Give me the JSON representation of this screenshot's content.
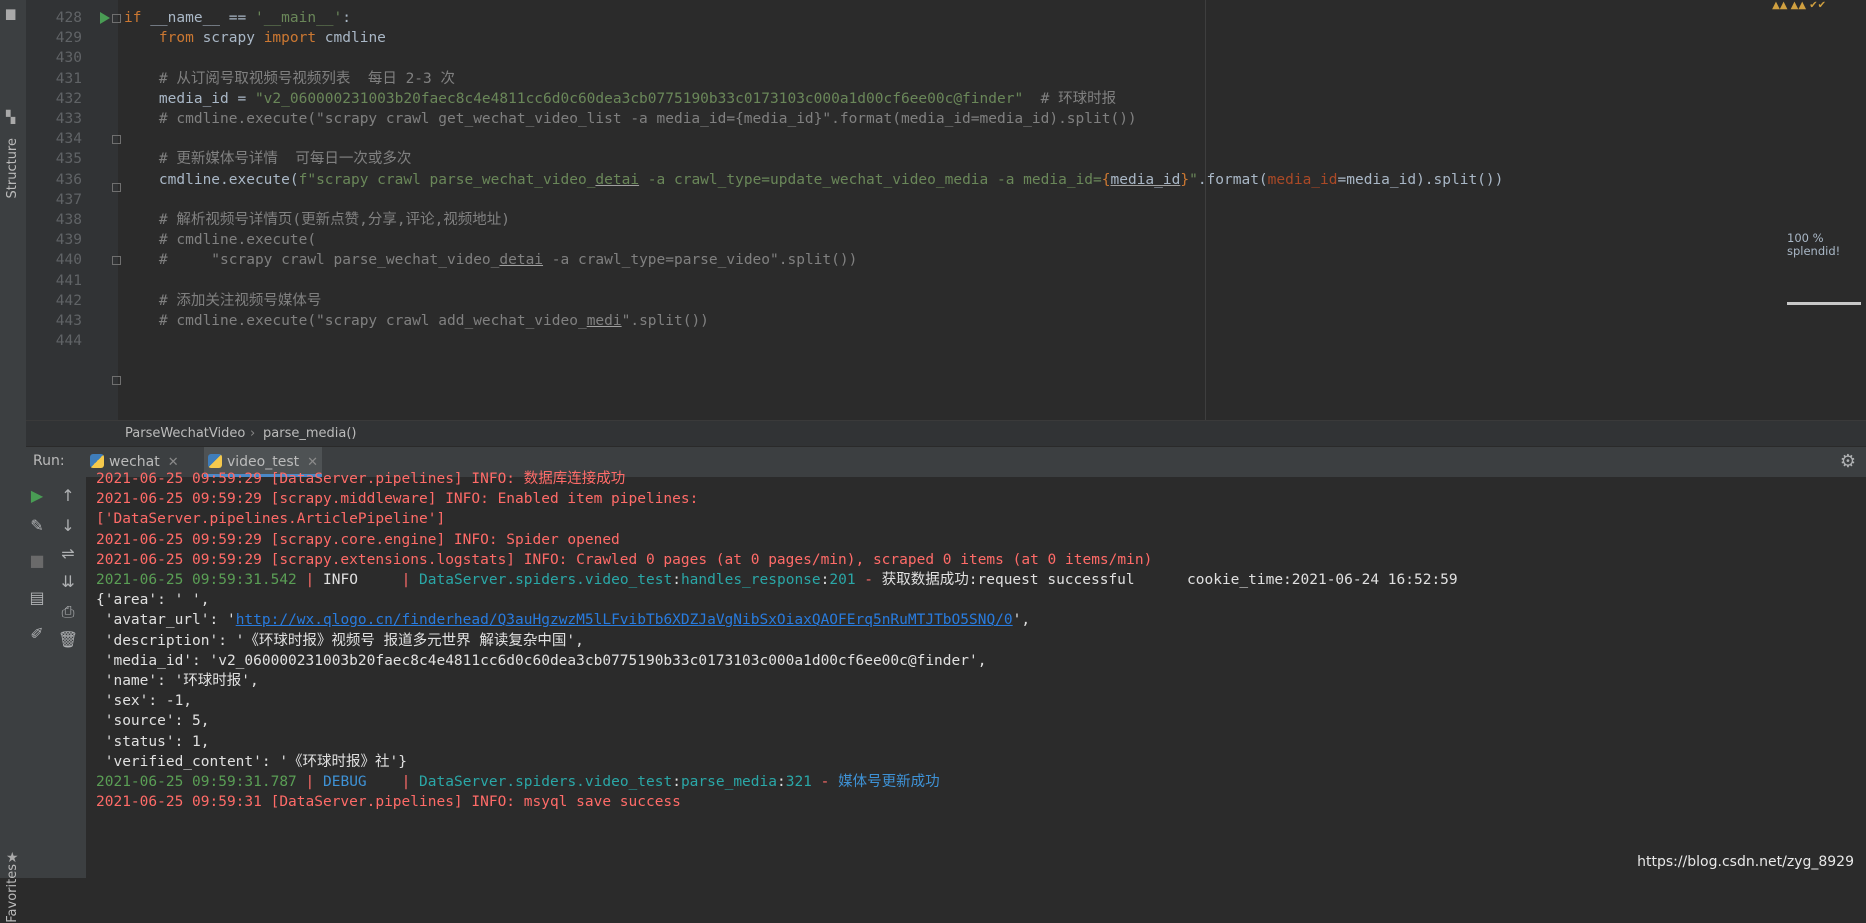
{
  "sidebar": {
    "structure_label": "Structure",
    "favorites_label": "Favorites"
  },
  "editor": {
    "lines": [
      {
        "num": "428",
        "segs": [
          [
            "kw",
            "if "
          ],
          [
            "plain",
            "__name__ == "
          ],
          [
            "str",
            "'__main__'"
          ],
          [
            "plain",
            ":"
          ]
        ]
      },
      {
        "num": "429",
        "segs": [
          [
            "plain",
            "    "
          ],
          [
            "kw",
            "from "
          ],
          [
            "plain",
            "scrapy "
          ],
          [
            "kw",
            "import "
          ],
          [
            "plain",
            "cmdline"
          ]
        ]
      },
      {
        "num": "430",
        "segs": []
      },
      {
        "num": "431",
        "segs": [
          [
            "cmt",
            "    # 从订阅号取视频号视频列表  每日 2-3 次"
          ]
        ]
      },
      {
        "num": "432",
        "segs": [
          [
            "plain",
            "    media_id = "
          ],
          [
            "str",
            "\"v2_060000231003b20faec8c4e4811cc6d0c60dea3cb0775190b33c0173103c000a1d00cf6ee00c@finder\""
          ],
          [
            "cmt",
            "  # 环球时报"
          ]
        ]
      },
      {
        "num": "433",
        "segs": [
          [
            "cmt",
            "    # cmdline.execute(\"scrapy crawl get_wechat_video_list -a media_id={media_id}\".format(media_id=media_id).split())"
          ]
        ]
      },
      {
        "num": "434",
        "segs": []
      },
      {
        "num": "435",
        "segs": [
          [
            "cmt",
            "    # 更新媒体号详情  可每日一次或多次"
          ]
        ]
      },
      {
        "num": "436",
        "segs": [
          [
            "plain",
            "    cmdline.execute("
          ],
          [
            "str",
            "f\"scrapy crawl parse_wechat_video_"
          ],
          [
            "str uline",
            "detai"
          ],
          [
            "str",
            " -a crawl_type=update_wechat_video_media -a media_id="
          ],
          [
            "kw",
            "{"
          ],
          [
            "plain uline",
            "media_id"
          ],
          [
            "kw",
            "}"
          ],
          [
            "str",
            "\""
          ],
          [
            "plain",
            ".format("
          ],
          [
            "param",
            "media_id"
          ],
          [
            "plain",
            "=media_id).split())"
          ]
        ]
      },
      {
        "num": "437",
        "segs": []
      },
      {
        "num": "438",
        "segs": [
          [
            "cmt",
            "    # 解析视频号详情页(更新点赞,分享,评论,视频地址)"
          ]
        ]
      },
      {
        "num": "439",
        "segs": [
          [
            "cmt",
            "    # cmdline.execute("
          ]
        ]
      },
      {
        "num": "440",
        "segs": [
          [
            "cmt",
            "    #     \"scrapy crawl parse_wechat_video_"
          ],
          [
            "cmt uline",
            "detai"
          ],
          [
            "cmt",
            " -a crawl_type=parse_video\".split())"
          ]
        ]
      },
      {
        "num": "441",
        "segs": []
      },
      {
        "num": "442",
        "segs": [
          [
            "cmt",
            "    # 添加关注视频号媒体号"
          ]
        ]
      },
      {
        "num": "443",
        "segs": [
          [
            "cmt",
            "    # cmdline.execute(\"scrapy crawl add_wechat_video_"
          ],
          [
            "cmt uline",
            "medi"
          ],
          [
            "cmt",
            "\".split())"
          ]
        ]
      },
      {
        "num": "444",
        "segs": []
      }
    ],
    "inspection_percent": "100 %",
    "inspection_text": "splendid!"
  },
  "breadcrumb": {
    "class_name": "ParseWechatVideo",
    "separator": "›",
    "method_name": "parse_media()"
  },
  "run": {
    "label": "Run:",
    "tabs": [
      {
        "label": "wechat",
        "active": false
      },
      {
        "label": "video_test",
        "active": true
      }
    ]
  },
  "console": {
    "lines": [
      {
        "segs": [
          [
            "red",
            "2021-06-25 09:59:29 [DataServer.pipelines] INFO: 数据库连接成功"
          ]
        ]
      },
      {
        "segs": [
          [
            "red",
            "2021-06-25 09:59:29 [scrapy.middleware] INFO: Enabled item pipelines:"
          ]
        ]
      },
      {
        "segs": [
          [
            "red",
            "['DataServer.pipelines.ArticlePipeline']"
          ]
        ]
      },
      {
        "segs": [
          [
            "red",
            "2021-06-25 09:59:29 [scrapy.core.engine] INFO: Spider opened"
          ]
        ]
      },
      {
        "segs": [
          [
            "red",
            "2021-06-25 09:59:29 [scrapy.extensions.logstats] INFO: Crawled 0 pages (at 0 pages/min), scraped 0 items (at 0 items/min)"
          ]
        ]
      },
      {
        "segs": [
          [
            "green",
            "2021-06-25 09:59:31.542"
          ],
          [
            "red",
            " | "
          ],
          [
            "white",
            "INFO    "
          ],
          [
            "red",
            " | "
          ],
          [
            "teal",
            "DataServer.spiders.video_test"
          ],
          [
            "white",
            ":"
          ],
          [
            "teal",
            "handles_response"
          ],
          [
            "white",
            ":"
          ],
          [
            "teal",
            "201"
          ],
          [
            "red",
            " - "
          ],
          [
            "white",
            "获取数据成功:request successful      cookie_time:2021-06-24 16:52:59"
          ]
        ]
      },
      {
        "segs": [
          [
            "white",
            "{'area': ' ',"
          ]
        ]
      },
      {
        "segs": [
          [
            "white",
            " 'avatar_url': '"
          ],
          [
            "link",
            "http://wx.qlogo.cn/finderhead/Q3auHgzwzM5lLFvibTb6XDZJaVgNibSxOiaxQAOFErq5nRuMTJTbO5SNQ/0"
          ],
          [
            "white",
            "',"
          ]
        ]
      },
      {
        "segs": [
          [
            "white",
            " 'description': '《环球时报》视频号 报道多元世界 解读复杂中国',"
          ]
        ]
      },
      {
        "segs": [
          [
            "white",
            " 'media_id': 'v2_060000231003b20faec8c4e4811cc6d0c60dea3cb0775190b33c0173103c000a1d00cf6ee00c@finder',"
          ]
        ]
      },
      {
        "segs": [
          [
            "white",
            " 'name': '环球时报',"
          ]
        ]
      },
      {
        "segs": [
          [
            "white",
            " 'sex': -1,"
          ]
        ]
      },
      {
        "segs": [
          [
            "white",
            " 'source': 5,"
          ]
        ]
      },
      {
        "segs": [
          [
            "white",
            " 'status': 1,"
          ]
        ]
      },
      {
        "segs": [
          [
            "white",
            " 'verified_content': '《环球时报》社'}"
          ]
        ]
      },
      {
        "segs": [
          [
            "green",
            "2021-06-25 09:59:31.787"
          ],
          [
            "red",
            " | "
          ],
          [
            "blue",
            "DEBUG   "
          ],
          [
            "red",
            " | "
          ],
          [
            "teal",
            "DataServer.spiders.video_test"
          ],
          [
            "white",
            ":"
          ],
          [
            "teal",
            "parse_media"
          ],
          [
            "white",
            ":"
          ],
          [
            "teal",
            "321"
          ],
          [
            "red",
            " - "
          ],
          [
            "blue",
            "媒体号更新成功"
          ]
        ]
      },
      {
        "segs": [
          [
            "red",
            "2021-06-25 09:59:31 [DataServer.pipelines] INFO: msyql save success"
          ]
        ]
      }
    ]
  },
  "watermark": "https://blog.csdn.net/zyg_8929"
}
